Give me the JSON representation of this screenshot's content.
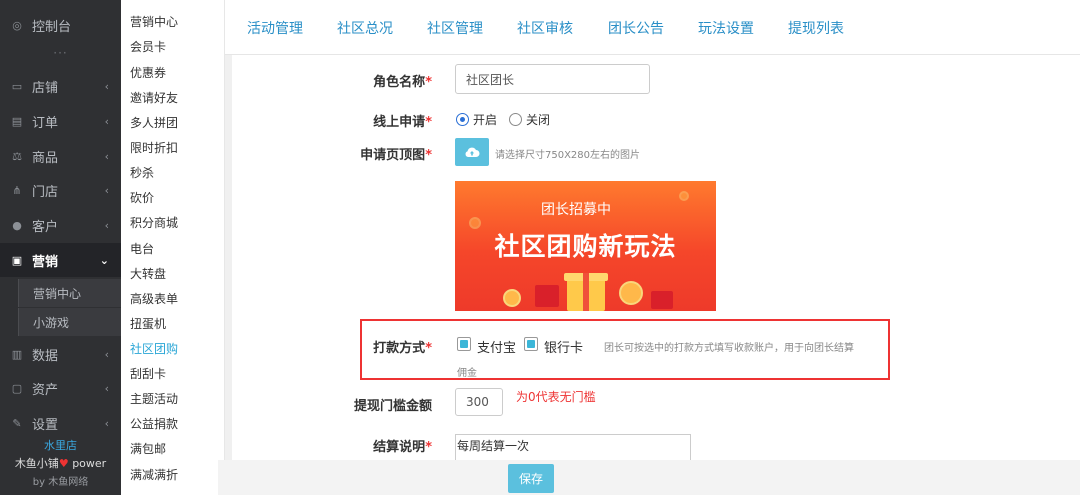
{
  "sidebar": {
    "dashboard": "控制台",
    "dots": "···",
    "items": [
      {
        "label": "店铺"
      },
      {
        "label": "订单"
      },
      {
        "label": "商品"
      },
      {
        "label": "门店"
      },
      {
        "label": "客户"
      },
      {
        "label": "营销"
      },
      {
        "label": "数据"
      },
      {
        "label": "资产"
      },
      {
        "label": "设置"
      }
    ],
    "sub_items": [
      "营销中心",
      "小游戏"
    ],
    "footer": {
      "shop": "水里店",
      "brand": "木鱼小铺",
      "power": "power",
      "by": "by 木鱼网络",
      "heart_color": "#e33"
    }
  },
  "subnav": {
    "items": [
      "营销中心",
      "会员卡",
      "优惠券",
      "邀请好友",
      "多人拼团",
      "限时折扣",
      "秒杀",
      "砍价",
      "积分商城",
      "电台",
      "大转盘",
      "高级表单",
      "扭蛋机",
      "社区团购",
      "刮刮卡",
      "主题活动",
      "公益捐款",
      "满包邮",
      "满减满折"
    ],
    "active": "社区团购"
  },
  "tabs": [
    "活动管理",
    "社区总况",
    "社区管理",
    "社区审核",
    "团长公告",
    "玩法设置",
    "提现列表"
  ],
  "form": {
    "role_name": {
      "label": "角色名称",
      "value": "社区团长"
    },
    "online_apply": {
      "label": "线上申请",
      "on_label": "开启",
      "off_label": "关闭",
      "selected": "开启"
    },
    "apply_image": {
      "label": "申请页顶图",
      "hint": "请选择尺寸750X280左右的图片"
    },
    "banner": {
      "small_text": "团长招募中",
      "big_text": "社区团购新玩法"
    },
    "payment": {
      "label": "打款方式",
      "options": [
        {
          "label": "支付宝",
          "checked": true
        },
        {
          "label": "银行卡",
          "checked": true
        }
      ],
      "hint_line1": "团长可按选中的打款方式填写收款账户，用于向团长结算",
      "hint_line2": "佣金"
    },
    "withdraw": {
      "label": "提现门槛金额",
      "value": "300",
      "note": "为0代表无门槛"
    },
    "settle": {
      "label": "结算说明",
      "value": "每周结算一次"
    }
  },
  "save_label": "保存",
  "colors": {
    "accent": "#5bc0de",
    "tab": "#2a8fc7",
    "active_nav": "#2aa6d6",
    "required": "#e33"
  }
}
